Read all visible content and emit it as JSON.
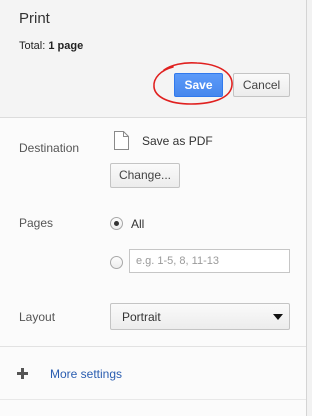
{
  "header": {
    "title": "Print",
    "total_prefix": "Total:",
    "total_value": "1 page",
    "save_label": "Save",
    "cancel_label": "Cancel"
  },
  "destination": {
    "label": "Destination",
    "printer_name": "Save as PDF",
    "printer_icon": "file-icon",
    "change_label": "Change..."
  },
  "pages": {
    "label": "Pages",
    "all_label": "All",
    "all_selected": true,
    "custom_value": "",
    "custom_placeholder": "e.g. 1-5, 8, 11-13"
  },
  "layout": {
    "label": "Layout",
    "selected": "Portrait"
  },
  "more_settings": {
    "label": "More settings",
    "icon": "plus-icon"
  },
  "colors": {
    "save_button": "#4d90fe",
    "link": "#2a5db0",
    "annotation": "#e0201f"
  }
}
